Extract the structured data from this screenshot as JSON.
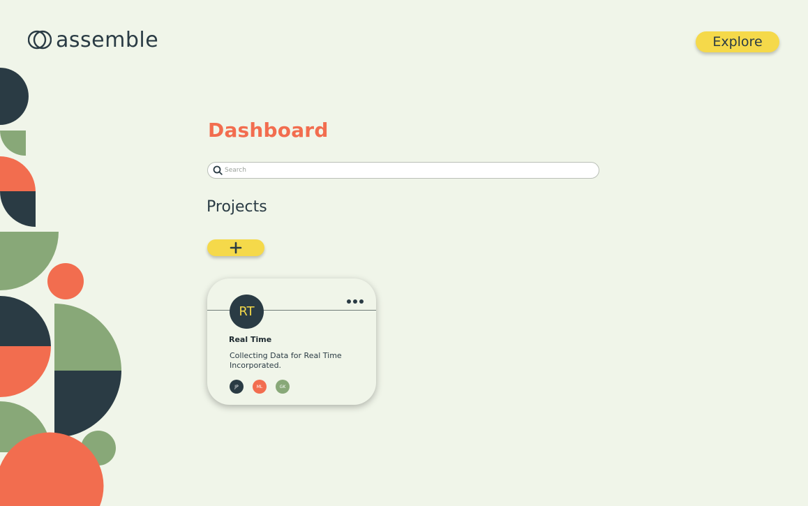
{
  "brand": {
    "name": "assemble"
  },
  "nav": {
    "explore_label": "Explore"
  },
  "page": {
    "title": "Dashboard"
  },
  "search": {
    "placeholder": "Search",
    "value": ""
  },
  "projects": {
    "section_title": "Projects",
    "add_label": "+",
    "items": [
      {
        "initials": "RT",
        "name": "Real Time",
        "description": "Collecting Data for Real Time Incorporated.",
        "members": [
          {
            "initials": "JP",
            "color": "#2a3b44"
          },
          {
            "initials": "ML",
            "color": "#f26d4f"
          },
          {
            "initials": "GK",
            "color": "#88a878"
          }
        ]
      }
    ]
  },
  "colors": {
    "background": "#f0f5e9",
    "accent_yellow": "#f5d94a",
    "accent_orange": "#f26d4f",
    "dark_slate": "#2a3b44",
    "sage_green": "#88a878"
  }
}
